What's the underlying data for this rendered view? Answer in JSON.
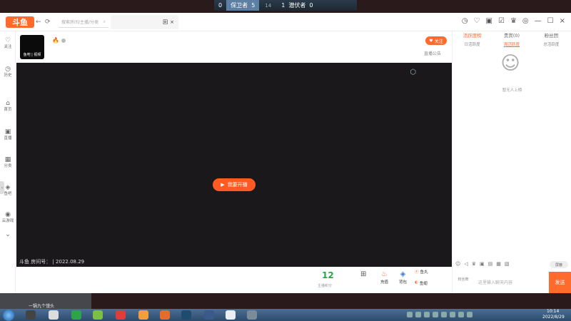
{
  "scoreboard": {
    "left_score": "0",
    "team_a": "保卫者",
    "team_a_score": "5",
    "round": "14",
    "team_b_score": "1",
    "team_b": "潜伏者",
    "right_score": "0"
  },
  "header": {
    "logo": "斗鱼",
    "back": "←",
    "refresh": "⟳",
    "search_placeholder": "搜索房间/主播/分类",
    "search_icon": "⌕",
    "tab_label": "回",
    "tab_close": "×",
    "icons": [
      "◷",
      "♡",
      "▣",
      "☑",
      "♛",
      "◎",
      "—",
      "☐",
      "×"
    ]
  },
  "sidebar": {
    "items": [
      {
        "icon": "♡",
        "label": "关注"
      },
      {
        "icon": "◷",
        "label": "历史"
      },
      {
        "icon": "⌂",
        "label": "首页"
      },
      {
        "icon": "▣",
        "label": "直播"
      },
      {
        "icon": "▦",
        "label": "分类"
      },
      {
        "icon": "◈",
        "label": "鱼吧"
      },
      {
        "icon": "◉",
        "label": "云游戏"
      },
      {
        "icon": "⌄",
        "label": ""
      }
    ],
    "expand": "‹"
  },
  "streamer": {
    "avatar_label": "鱼吧 | 视频",
    "flame": "🔥",
    "follow_label": "关注",
    "follow_icon": "♥",
    "notice_label": "直播公告"
  },
  "player": {
    "start_label": "我要开播",
    "start_icon": "▶",
    "corner_icon": "⬡",
    "room_info": "斗鱼 房间号： | 2022.08.29"
  },
  "toolbar": {
    "level": "12",
    "level_label": "主播积分",
    "items": [
      {
        "icon": "⊞",
        "label": ""
      },
      {
        "icon": "♨",
        "label": "充值"
      },
      {
        "icon": "◈",
        "label": "背包"
      },
      {
        "icon": "Ⓕ",
        "label": "鱼丸"
      },
      {
        "icon": "◐",
        "label": "鱼翅"
      }
    ]
  },
  "right_panel": {
    "rank_tabs": [
      "活跃度榜",
      "贵宾(0)",
      "粉丝团"
    ],
    "sub_tabs": [
      "日活跃度",
      "周活跃度",
      "总活跃度"
    ],
    "mascot": "☺",
    "empty_text": "暂无人上榜",
    "chat_tools": [
      "☺",
      "◁",
      "♛",
      "▣",
      "▤",
      "▦",
      "▧"
    ],
    "mask_label": "屏蔽",
    "fan_badge": "粉丝牌",
    "chat_placeholder": "这里输入聊天内容",
    "send_label": "发送"
  },
  "hud": {
    "text": "一锅九个馒头"
  },
  "taskbar": {
    "time": "10:14",
    "date": "2022/8/29",
    "icon_colors": [
      "#444",
      "#ddd",
      "#2ea34a",
      "#7bc043",
      "#e33b3b",
      "#f29e3a",
      "#e66b2c",
      "#1e4b6e",
      "#3a5b8a",
      "#e9eef5",
      "#7a8b99"
    ]
  }
}
